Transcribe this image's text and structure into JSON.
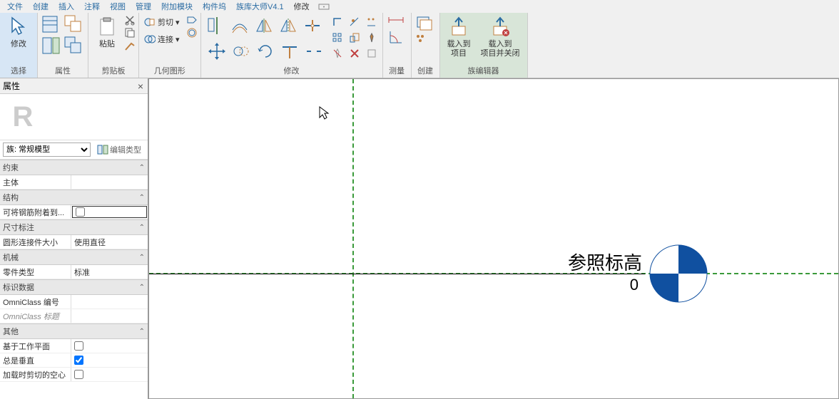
{
  "menubar": {
    "tabs": [
      "文件",
      "创建",
      "插入",
      "注释",
      "视图",
      "管理",
      "附加模块",
      "构件坞",
      "族库大师V4.1",
      "修改"
    ],
    "active_index": 9
  },
  "ribbon": {
    "select_panel": {
      "modify_label": "修改",
      "title": "选择"
    },
    "properties_panel": {
      "title": "属性"
    },
    "clipboard_panel": {
      "paste_label": "粘贴",
      "cut_label": "剪切",
      "join_label": "连接",
      "title": "剪贴板"
    },
    "geometry_panel": {
      "title": "几何图形"
    },
    "modify_panel": {
      "title": "修改"
    },
    "measure_panel": {
      "title": "测量"
    },
    "create_panel": {
      "title": "创建"
    },
    "family_editor_panel": {
      "load_project_label": "载入到\n项目",
      "load_close_label": "载入到\n项目并关闭",
      "title": "族编辑器"
    }
  },
  "props": {
    "title": "属性",
    "family_select": "族: 常规模型",
    "edit_type": "编辑类型",
    "sections": {
      "constraint": "约束",
      "host": {
        "k": "主体",
        "v": ""
      },
      "structure": "结构",
      "rebar_attach": {
        "k": "可将钢筋附着到...",
        "v": false
      },
      "dimension": "尺寸标注",
      "round_conn": {
        "k": "圆形连接件大小",
        "v": "使用直径"
      },
      "mechanical": "机械",
      "part_type": {
        "k": "零件类型",
        "v": "标准"
      },
      "identity": "标识数据",
      "omni_num": {
        "k": "OmniClass 编号",
        "v": ""
      },
      "omni_title": {
        "k": "OmniClass 标题",
        "v": ""
      },
      "other": "其他",
      "workplane": {
        "k": "基于工作平面",
        "v": false
      },
      "always_vert": {
        "k": "总是垂直",
        "v": true
      },
      "cut_void": {
        "k": "加载时剪切的空心",
        "v": false
      }
    }
  },
  "canvas": {
    "level_label": "参照标高",
    "level_value": "0"
  }
}
